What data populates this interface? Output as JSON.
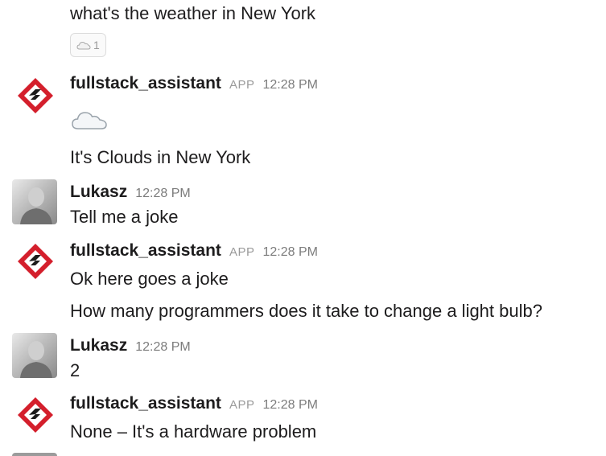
{
  "messages": [
    {
      "text": "what's the weather in New York",
      "reaction": {
        "icon": "cloud-icon",
        "count": "1"
      }
    },
    {
      "author": "fullstack_assistant",
      "app_badge": "APP",
      "time": "12:28 PM",
      "icon": "cloud-icon",
      "text": "It's Clouds in New York"
    },
    {
      "author": "Lukasz",
      "time": "12:28 PM",
      "text": "Tell me a joke"
    },
    {
      "author": "fullstack_assistant",
      "app_badge": "APP",
      "time": "12:28 PM",
      "lines": [
        "Ok here goes a joke",
        "How many programmers does it take to change a light bulb?"
      ]
    },
    {
      "author": "Lukasz",
      "time": "12:28 PM",
      "text": "2"
    },
    {
      "author": "fullstack_assistant",
      "app_badge": "APP",
      "time": "12:28 PM",
      "text": "None – It's a hardware problem"
    }
  ],
  "colors": {
    "bot_logo_red": "#d41f2c",
    "bot_logo_dark": "#1b1b1b",
    "text": "#1d1c1d",
    "muted": "#7c7c7c"
  }
}
